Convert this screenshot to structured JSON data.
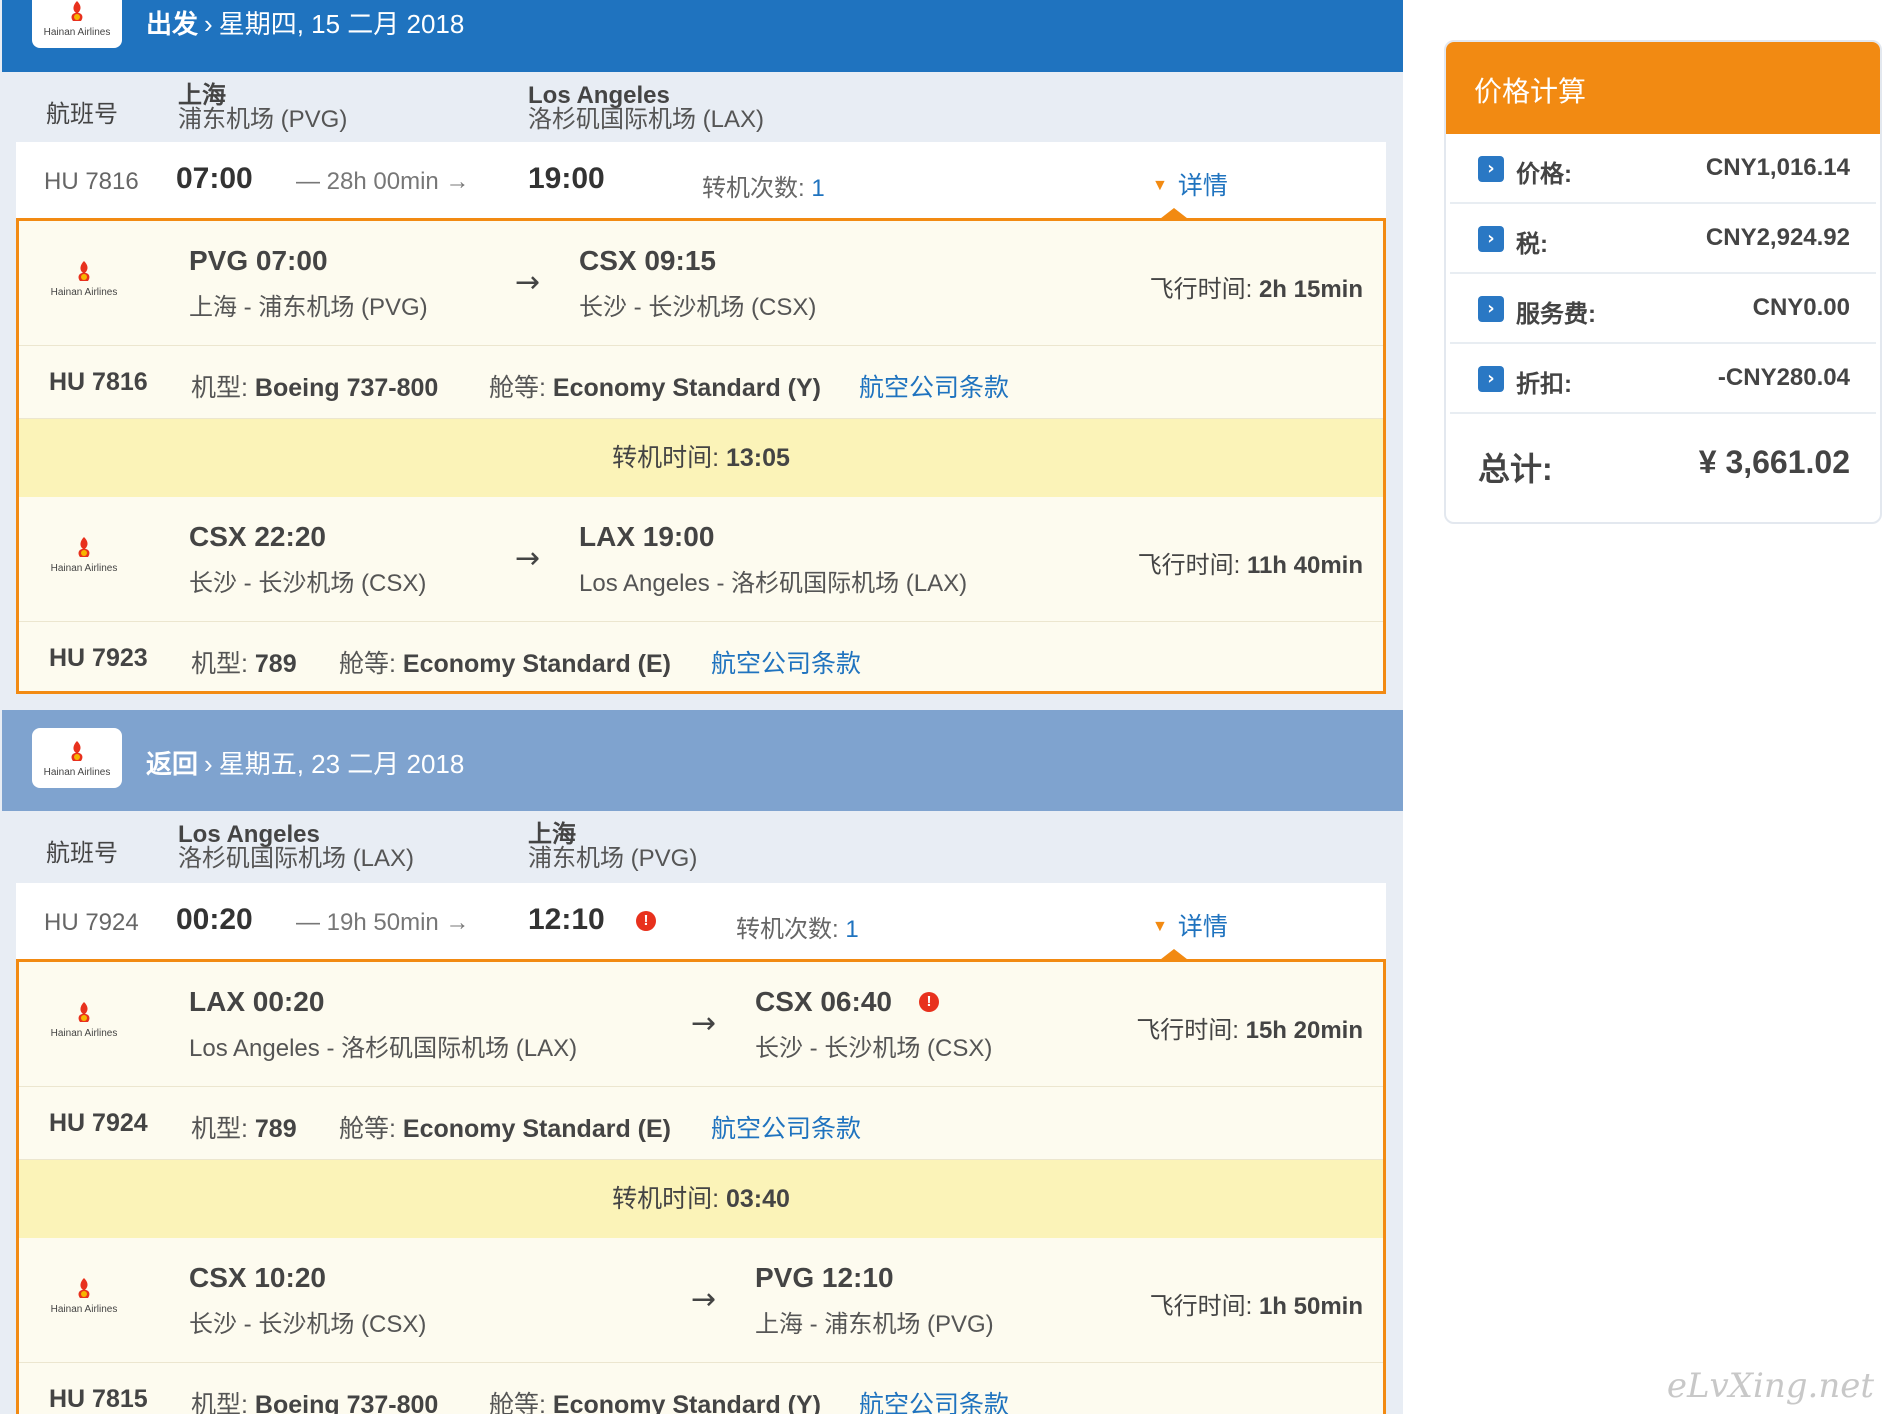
{
  "airline_logo_text": "Hainan Airlines",
  "colors": {
    "header_out": "#1f73bf",
    "header_return": "#7fa3cf",
    "accent_orange": "#f28a12",
    "link_blue": "#1f73bf",
    "layover_yellow": "#fbf3b8"
  },
  "outbound": {
    "direction": "出发",
    "date": "星期四, 15 二月 2018",
    "col_label": "航班号",
    "from_city": "上海",
    "from_airport": "浦东机场 (PVG)",
    "to_city": "Los Angeles",
    "to_airport": "洛杉矶国际机场 (LAX)",
    "summary": {
      "flight": "HU 7816",
      "dep_time": "07:00",
      "duration": "— 28h 00min →",
      "arr_time": "19:00",
      "stops_label": "转机次数:",
      "stops": "1",
      "details": "详情"
    },
    "segments": [
      {
        "dep_code": "PVG 07:00",
        "dep_name": "上海 - 浦东机场 (PVG)",
        "arr_code": "CSX 09:15",
        "arr_name": "长沙 - 长沙机场 (CSX)",
        "ft_label": "飞行时间:",
        "ft": "2h 15min",
        "flight": "HU 7816",
        "aircraft_label": "机型:",
        "aircraft": "Boeing 737-800",
        "cabin_label": "舱等:",
        "cabin": "Economy Standard (Y)",
        "rules": "航空公司条款"
      },
      {
        "dep_code": "CSX 22:20",
        "dep_name": "长沙 - 长沙机场 (CSX)",
        "arr_code": "LAX 19:00",
        "arr_name": "Los Angeles - 洛杉矶国际机场 (LAX)",
        "ft_label": "飞行时间:",
        "ft": "11h 40min",
        "flight": "HU 7923",
        "aircraft_label": "机型:",
        "aircraft": "789",
        "cabin_label": "舱等:",
        "cabin": "Economy Standard (E)",
        "rules": "航空公司条款"
      }
    ],
    "layover_label": "转机时间:",
    "layover": "13:05"
  },
  "return": {
    "direction": "返回",
    "date": "星期五, 23 二月 2018",
    "col_label": "航班号",
    "from_city": "Los Angeles",
    "from_airport": "洛杉矶国际机场 (LAX)",
    "to_city": "上海",
    "to_airport": "浦东机场 (PVG)",
    "summary": {
      "flight": "HU 7924",
      "dep_time": "00:20",
      "duration": "— 19h 50min →",
      "arr_time": "12:10",
      "stops_label": "转机次数:",
      "stops": "1",
      "details": "详情"
    },
    "segments": [
      {
        "dep_code": "LAX 00:20",
        "dep_name": "Los Angeles - 洛杉矶国际机场 (LAX)",
        "arr_code": "CSX 06:40",
        "arr_name": "长沙 - 长沙机场 (CSX)",
        "ft_label": "飞行时间:",
        "ft": "15h 20min",
        "flight": "HU 7924",
        "aircraft_label": "机型:",
        "aircraft": "789",
        "cabin_label": "舱等:",
        "cabin": "Economy Standard (E)",
        "rules": "航空公司条款"
      },
      {
        "dep_code": "CSX 10:20",
        "dep_name": "长沙 - 长沙机场 (CSX)",
        "arr_code": "PVG 12:10",
        "arr_name": "上海 - 浦东机场 (PVG)",
        "ft_label": "飞行时间:",
        "ft": "1h 50min",
        "flight": "HU 7815",
        "aircraft_label": "机型:",
        "aircraft": "Boeing 737-800",
        "cabin_label": "舱等:",
        "cabin": "Economy Standard (Y)",
        "rules": "航空公司条款"
      }
    ],
    "layover_label": "转机时间:",
    "layover": "03:40"
  },
  "price": {
    "title": "价格计算",
    "rows": [
      {
        "label": "价格:",
        "value": "CNY1,016.14"
      },
      {
        "label": "税:",
        "value": "CNY2,924.92"
      },
      {
        "label": "服务费:",
        "value": "CNY0.00"
      },
      {
        "label": "折扣:",
        "value": "-CNY280.04"
      }
    ],
    "total_label": "总计:",
    "total": "¥ 3,661.02"
  },
  "watermark": "eLvXing.net",
  "warning_glyph": "!",
  "arrow_glyph": "→",
  "chevron_glyph": "›",
  "header_separator": "›"
}
